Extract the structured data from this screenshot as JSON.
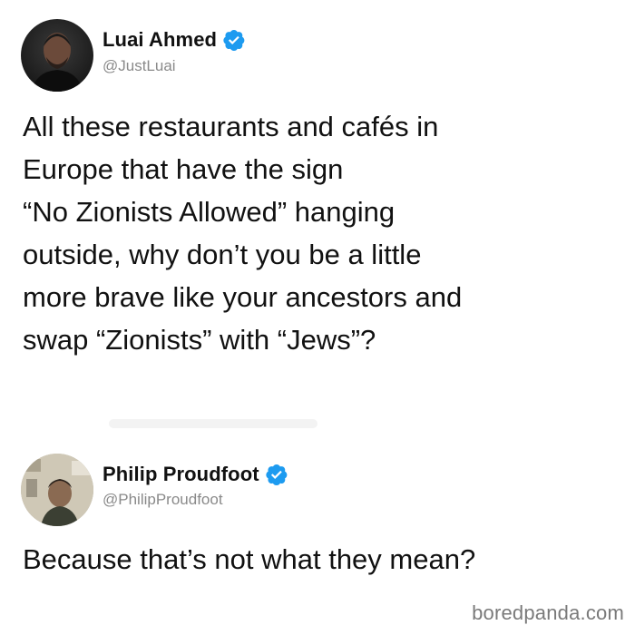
{
  "tweets": [
    {
      "display_name": "Luai Ahmed",
      "handle": "@JustLuai",
      "verified_icon": "verified-badge-icon",
      "text": "All these restaurants and cafés in\nEurope that have the sign\n“No Zionists Allowed” hanging\noutside, why don’t you be a little\nmore brave like your ancestors and\nswap “Zionists” with “Jews”?"
    },
    {
      "display_name": "Philip Proudfoot",
      "handle": "@PhilipProudfoot",
      "verified_icon": "verified-badge-icon",
      "text": "Because that’s not what they mean?"
    }
  ],
  "watermark": "boredpanda.com",
  "colors": {
    "verified_blue": "#1d9bf0",
    "handle_gray": "#8a8a8a",
    "text": "#111111",
    "background": "#ffffff"
  }
}
